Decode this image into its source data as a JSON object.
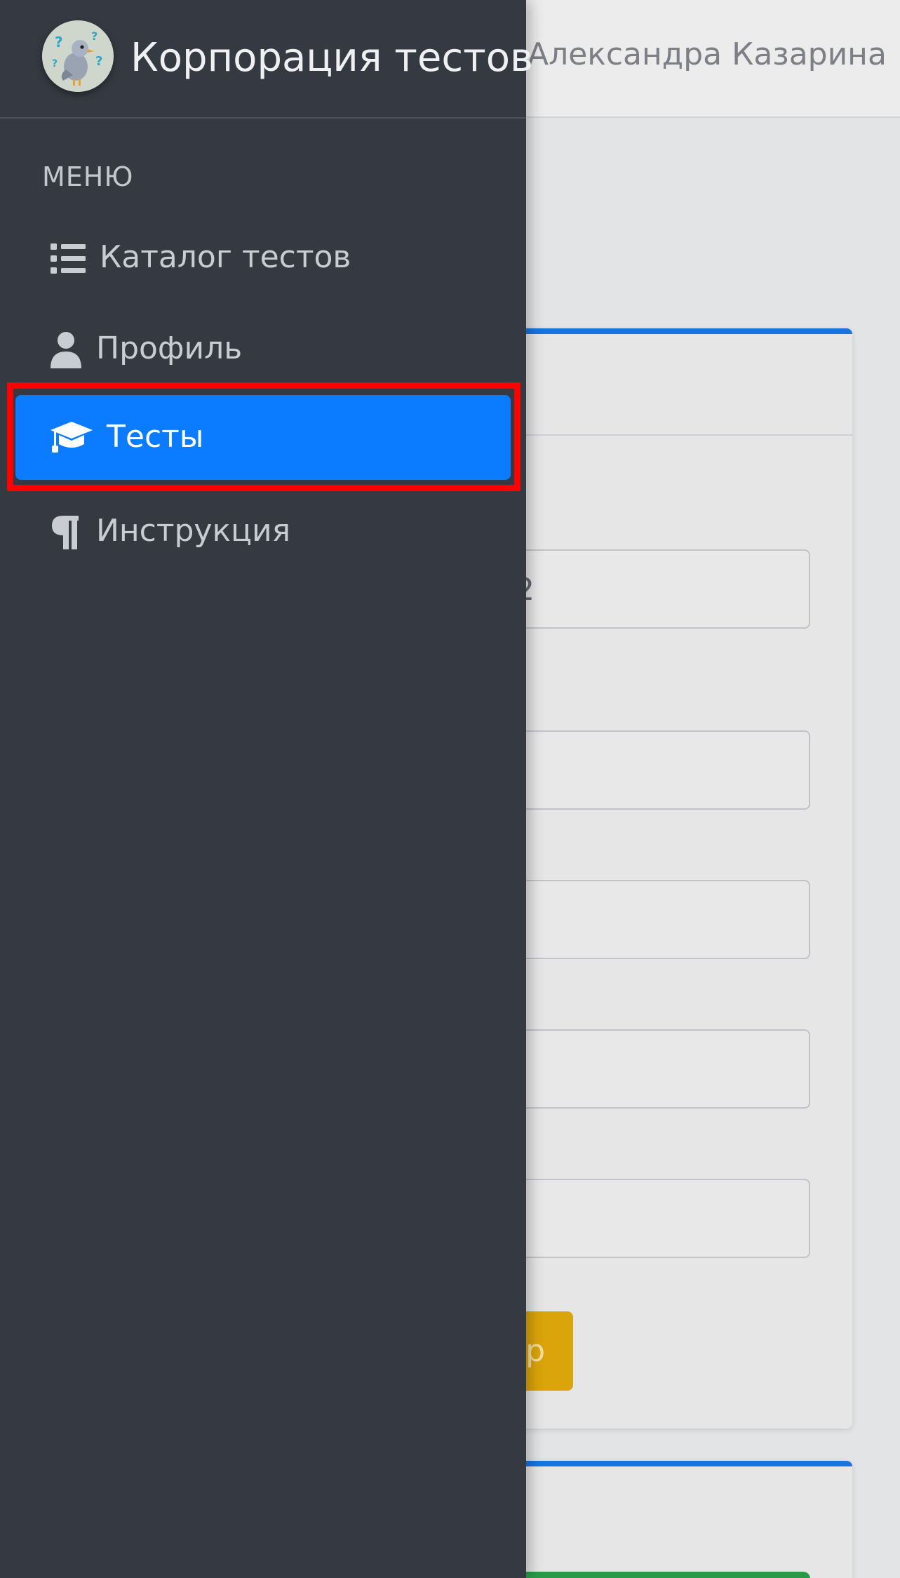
{
  "topbar": {
    "user_name": "Александра Казарина"
  },
  "main": {
    "first_field_value_fragment": "2",
    "submit_button_fragment": "р"
  },
  "sidebar": {
    "brand_name": "Корпорация тестов",
    "logo_icon": "pigeon-with-question-marks-logo",
    "menu_header": "МЕНЮ",
    "items": [
      {
        "label": "Каталог тестов",
        "icon": "list-icon",
        "active": false
      },
      {
        "label": "Профиль",
        "icon": "user-icon",
        "active": false
      },
      {
        "label": "Тесты",
        "icon": "graduation-cap-icon",
        "active": true
      },
      {
        "label": "Инструкция",
        "icon": "paragraph-icon",
        "active": false
      }
    ]
  },
  "colors": {
    "sidebar_bg": "#353a42",
    "active_item_bg": "#0b7cff",
    "highlight_border": "#ff0000",
    "card_accent": "#1775e0",
    "warning_button": "#dba40a",
    "success_button": "#2a9a48"
  }
}
